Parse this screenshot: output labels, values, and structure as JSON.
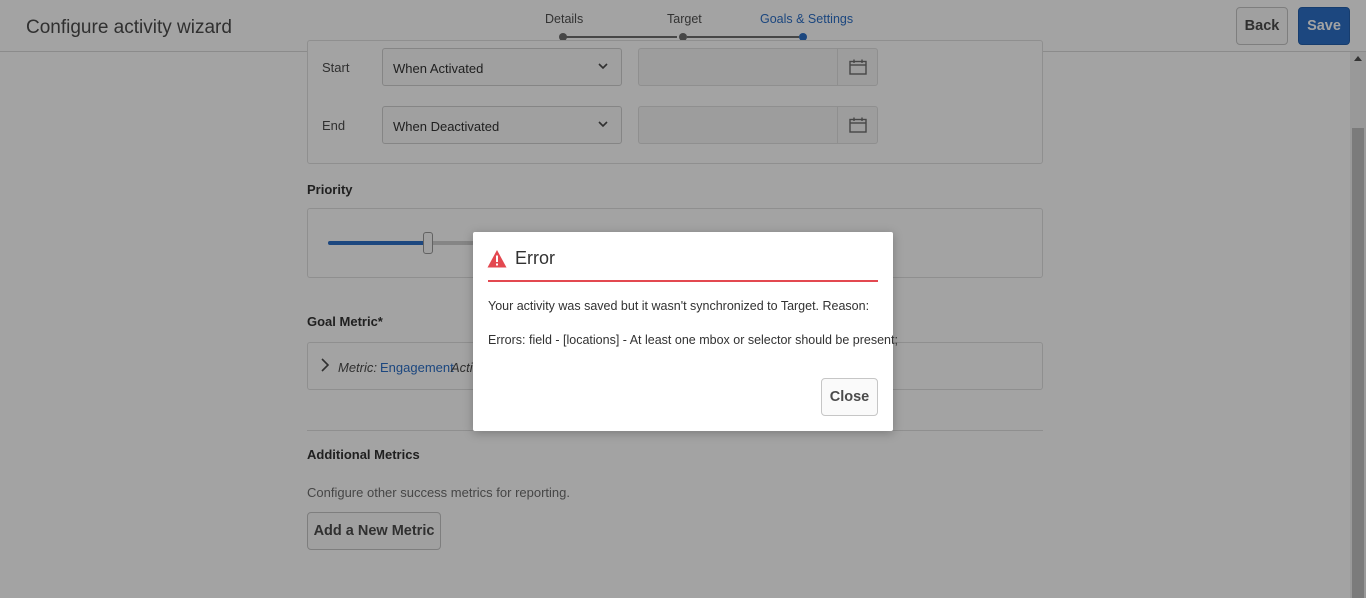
{
  "header": {
    "title": "Configure activity wizard",
    "steps": [
      {
        "label": "Details",
        "state": "complete"
      },
      {
        "label": "Target",
        "state": "complete"
      },
      {
        "label": "Goals & Settings",
        "state": "current"
      }
    ],
    "back_label": "Back",
    "save_label": "Save"
  },
  "schedule": {
    "start_label": "Start",
    "start_value": "When Activated",
    "end_label": "End",
    "end_value": "When Deactivated",
    "start_date_icon": "calendar-icon",
    "end_date_icon": "calendar-icon"
  },
  "priority": {
    "title": "Priority",
    "value_fraction": 0.4
  },
  "goal_metric": {
    "title": "Goal Metric*",
    "metric_label": "Metric:",
    "metric_value": "Engagement",
    "action_partial": "Acti"
  },
  "additional_metrics": {
    "title": "Additional Metrics",
    "help": "Configure other success metrics for reporting.",
    "add_label": "Add a New Metric"
  },
  "dialog": {
    "title": "Error",
    "icon": "alert-icon",
    "message_1": "Your activity was saved but it wasn't synchronized to Target. Reason:",
    "message_2": "Errors: field - [locations] - At least one mbox or selector should be present;",
    "close_label": "Close"
  },
  "colors": {
    "accent": "#2c6fc7",
    "error": "#e34850"
  }
}
